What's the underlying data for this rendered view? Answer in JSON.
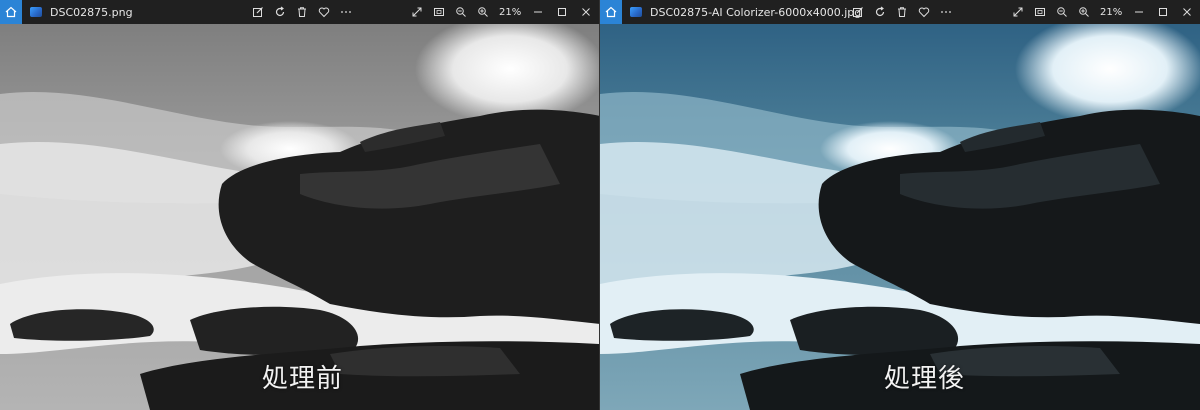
{
  "windows": [
    {
      "filename": "DSC02875.png",
      "zoom": "21%",
      "caption": "処理前",
      "colors": {
        "sky": "#9a9a9a",
        "sea": "#8c8c8c",
        "foam": "#ececec",
        "rock": "#1e1e1e",
        "rock_hi": "#3a3a3a"
      }
    },
    {
      "filename": "DSC02875-AI Colorizer-6000x4000.jpg",
      "zoom": "21%",
      "caption": "処理後",
      "colors": {
        "sky": "#3f6f8e",
        "sea": "#3b6d8a",
        "foam": "#dfeef5",
        "rock": "#15181a",
        "rock_hi": "#2b3337"
      }
    }
  ],
  "toolbar_icons": [
    "edit-icon",
    "rotate-icon",
    "delete-icon",
    "favorite-icon",
    "more-icon"
  ],
  "view_icons": [
    "fullscreen-icon",
    "fit-icon",
    "zoom-out-icon",
    "zoom-in-icon"
  ],
  "window_controls": [
    "minimize-icon",
    "maximize-icon",
    "close-icon"
  ]
}
